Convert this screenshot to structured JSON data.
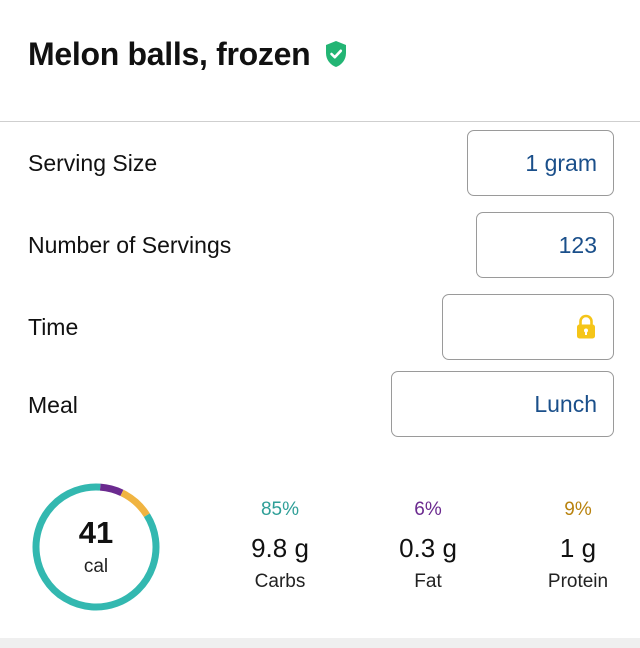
{
  "header": {
    "title": "Melon balls, frozen",
    "verified_icon": "shield-check-icon",
    "verified_color": "#23b574"
  },
  "form": {
    "serving_size": {
      "label": "Serving Size",
      "value": "1 gram"
    },
    "servings": {
      "label": "Number of Servings",
      "value": "123"
    },
    "time": {
      "label": "Time",
      "value": "",
      "icon": "lock-icon",
      "icon_color": "#f5c518"
    },
    "meal": {
      "label": "Meal",
      "value": "Lunch"
    }
  },
  "summary": {
    "calories": "41",
    "calories_unit": "cal",
    "ring": {
      "segments": [
        {
          "name": "carbs",
          "fraction": 0.85,
          "color": "#33b8b0"
        },
        {
          "name": "fat",
          "fraction": 0.06,
          "color": "#6b2a8f"
        },
        {
          "name": "protein",
          "fraction": 0.09,
          "color": "#f0b441"
        }
      ]
    },
    "macros": [
      {
        "percent": "85%",
        "amount": "9.8 g",
        "name": "Carbs",
        "color": "#2f9f98"
      },
      {
        "percent": "6%",
        "amount": "0.3 g",
        "name": "Fat",
        "color": "#6b2a8f"
      },
      {
        "percent": "9%",
        "amount": "1 g",
        "name": "Protein",
        "color": "#b9830f"
      }
    ]
  }
}
